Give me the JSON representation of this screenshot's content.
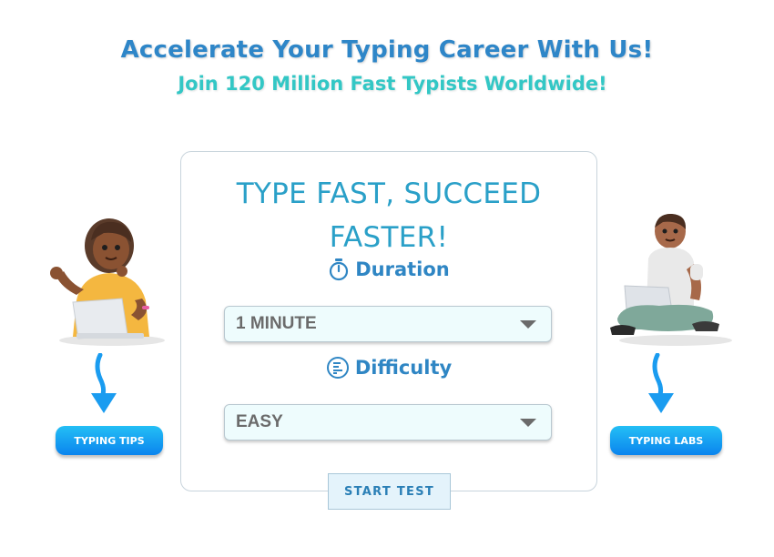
{
  "header": {
    "headline": "Accelerate Your Typing Career With Us!",
    "subheadline": "Join 120 Million Fast Typists Worldwide!"
  },
  "card": {
    "title_line1": "TYPE FAST, SUCCEED",
    "title_line2": "FASTER!",
    "duration": {
      "label": "Duration",
      "icon": "stopwatch-icon",
      "selected": "1 MINUTE"
    },
    "difficulty": {
      "label": "Difficulty",
      "icon": "difficulty-list-icon",
      "selected": "EASY"
    },
    "start_button": "START TEST"
  },
  "side_links": {
    "left": "TYPING TIPS",
    "right": "TYPING LABS"
  },
  "colors": {
    "headline": "#2e86c8",
    "subheadline": "#33c7c5",
    "card_title": "#2aa0c8",
    "label": "#2f86c4",
    "pill_gradient": [
      "#24bff5",
      "#0a84ee"
    ],
    "arrow": "#1a9cf0"
  }
}
